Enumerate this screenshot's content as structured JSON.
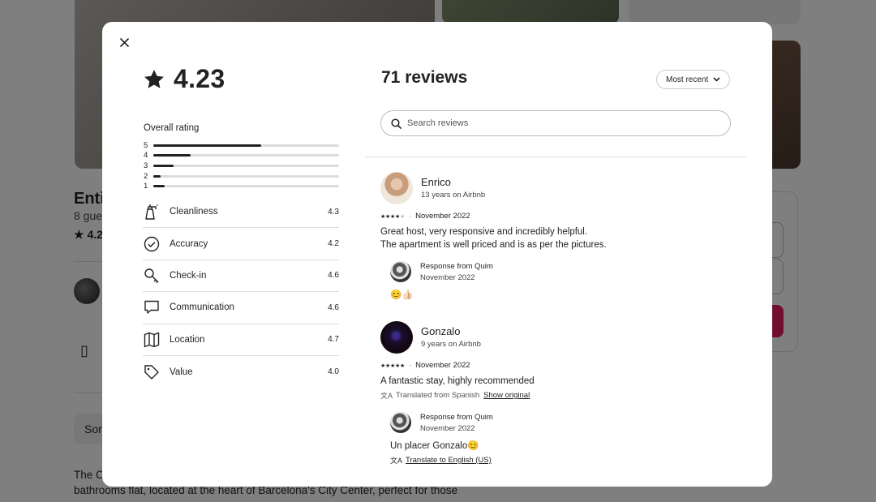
{
  "background": {
    "listing_title": "Entir",
    "listing_subtitle": "8 gue",
    "listing_rating": "4.2",
    "pill_label": "Son",
    "description_line1": "The C",
    "description_line2": "bathrooms flat, located at the heart of Barcelona's City Center, perfect for those"
  },
  "modal": {
    "close_icon": "close-icon",
    "rating": "4.23",
    "overall_label": "Overall rating",
    "distribution": [
      {
        "stars": "5",
        "fraction": 0.58
      },
      {
        "stars": "4",
        "fraction": 0.2
      },
      {
        "stars": "3",
        "fraction": 0.11
      },
      {
        "stars": "2",
        "fraction": 0.04
      },
      {
        "stars": "1",
        "fraction": 0.06
      }
    ],
    "categories": [
      {
        "label": "Cleanliness",
        "score": "4.3",
        "icon": "spray-bottle-icon"
      },
      {
        "label": "Accuracy",
        "score": "4.2",
        "icon": "check-circle-icon"
      },
      {
        "label": "Check-in",
        "score": "4.6",
        "icon": "key-icon"
      },
      {
        "label": "Communication",
        "score": "4.6",
        "icon": "chat-bubble-icon"
      },
      {
        "label": "Location",
        "score": "4.7",
        "icon": "map-icon"
      },
      {
        "label": "Value",
        "score": "4.0",
        "icon": "tag-icon"
      }
    ],
    "reviews_title": "71 reviews",
    "sort_label": "Most recent",
    "search_placeholder": "Search reviews",
    "reviews": [
      {
        "name": "Enrico",
        "meta": "13 years on Airbnb",
        "stars": 4,
        "date": "November 2022",
        "text_line1": "Great host, very responsive and incredibly helpful.",
        "text_line2": "The apartment is well priced and is as per the pictures.",
        "response_title": "Response from Quim",
        "response_date": "November 2022",
        "response_text": "😊👍🏻"
      },
      {
        "name": "Gonzalo",
        "meta": "9 years on Airbnb",
        "stars": 5,
        "date": "November 2022",
        "text_line1": "A fantastic stay, highly recommended",
        "translated_note": "Translated from Spanish",
        "show_original": "Show original",
        "response_title": "Response from Quim",
        "response_date": "November 2022",
        "response_text": "Un placer Gonzalo😊",
        "translate_link": "Translate to English (US)"
      }
    ]
  },
  "colors": {
    "accent": "#e31c5f",
    "text": "#222222",
    "divider": "#dddddd"
  }
}
